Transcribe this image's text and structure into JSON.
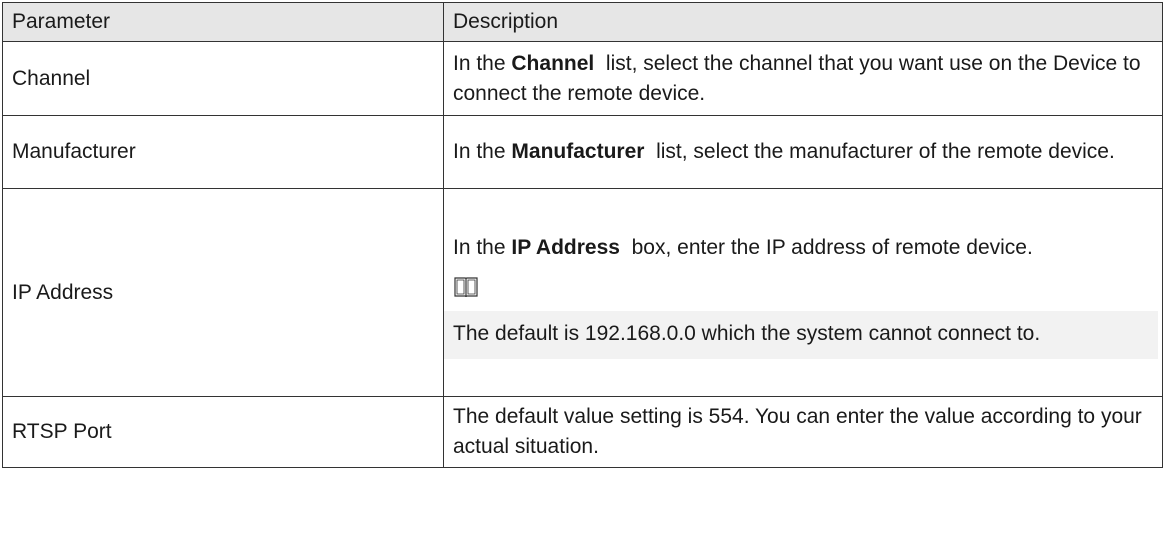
{
  "table": {
    "headers": {
      "parameter": "Parameter",
      "description": "Description"
    },
    "rows": [
      {
        "parameter": "Channel",
        "desc_pre": "In the ",
        "desc_bold": "Channel",
        "desc_post": "  list, select the channel that you want use on the Device to connect the remote device."
      },
      {
        "parameter": "Manufacturer",
        "desc_pre": "In the ",
        "desc_bold": "Manufacturer",
        "desc_post": "  list, select the manufacturer of the remote device."
      },
      {
        "parameter": "IP Address",
        "desc_pre": "In the ",
        "desc_bold": "IP Address",
        "desc_post": "  box, enter the IP address of remote device.",
        "note_icon": "book-icon",
        "note_text": "The default is 192.168.0.0 which the system cannot connect to."
      },
      {
        "parameter": "RTSP Port",
        "desc_text": "The default value setting is 554. You can enter the value according to your actual situation."
      }
    ]
  }
}
